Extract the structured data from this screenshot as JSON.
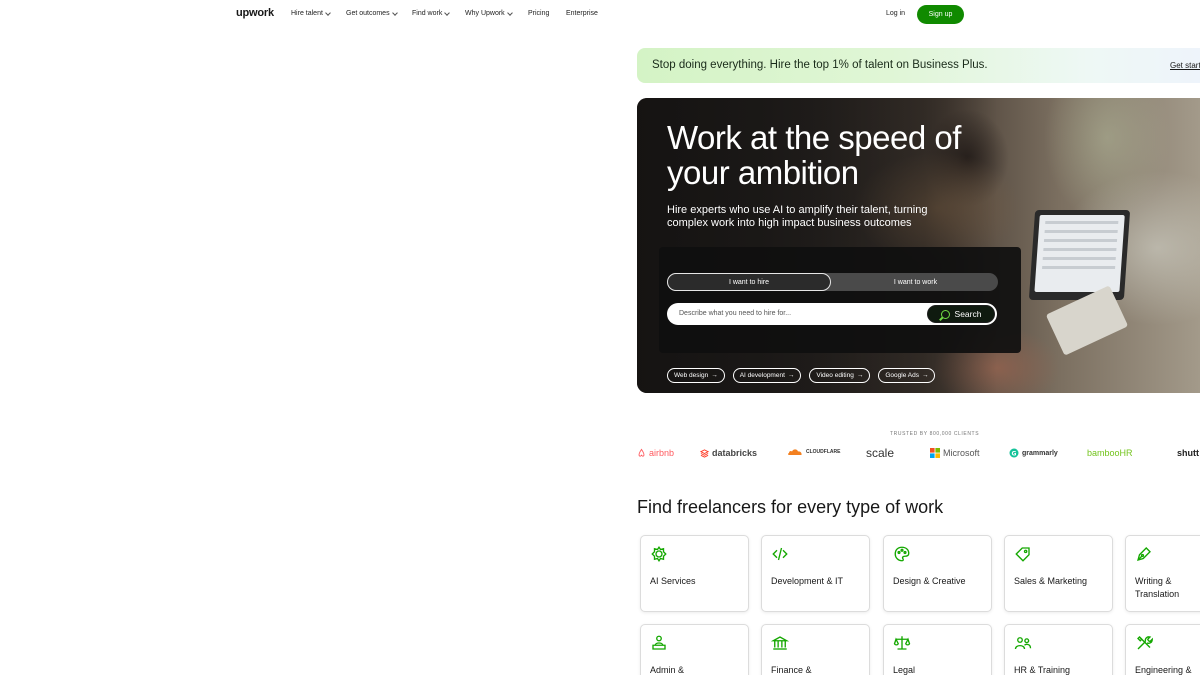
{
  "header": {
    "logo": "upwork",
    "nav": [
      {
        "label": "Hire talent",
        "dropdown": true
      },
      {
        "label": "Get outcomes",
        "dropdown": true
      },
      {
        "label": "Find work",
        "dropdown": true
      },
      {
        "label": "Why Upwork",
        "dropdown": true
      },
      {
        "label": "Pricing",
        "dropdown": false
      },
      {
        "label": "Enterprise",
        "dropdown": false
      }
    ],
    "login": "Log in",
    "signup": "Sign up"
  },
  "promo": {
    "text": "Stop doing everything. Hire the top 1% of talent on Business Plus.",
    "link": "Get started"
  },
  "hero": {
    "title": "Work at the speed of your ambition",
    "subtitle": "Hire experts who use AI to amplify their talent, turning complex work into high impact business outcomes",
    "tabs": [
      "I want to hire",
      "I want to work"
    ],
    "search_placeholder": "Describe what you need to hire for...",
    "search_button": "Search",
    "chips": [
      "Web design",
      "AI development",
      "Video editing",
      "Google Ads"
    ]
  },
  "trusted": {
    "label": "TRUSTED BY 800,000 CLIENTS",
    "brands": [
      "airbnb",
      "databricks",
      "CLOUDFLARE",
      "scale",
      "Microsoft",
      "grammarly",
      "bambooHR",
      "shutt"
    ]
  },
  "categories": {
    "title": "Find freelancers for every type of work",
    "items": [
      {
        "label": "AI Services",
        "icon": "ai-services-icon"
      },
      {
        "label": "Development & IT",
        "icon": "code-icon"
      },
      {
        "label": "Design & Creative",
        "icon": "palette-icon"
      },
      {
        "label": "Sales & Marketing",
        "icon": "tag-icon"
      },
      {
        "label": "Writing & Translation",
        "icon": "pen-icon"
      },
      {
        "label": "Admin &",
        "icon": "admin-icon"
      },
      {
        "label": "Finance &",
        "icon": "bank-icon"
      },
      {
        "label": "Legal",
        "icon": "scales-icon"
      },
      {
        "label": "HR & Training",
        "icon": "people-icon"
      },
      {
        "label": "Engineering &",
        "icon": "tools-icon"
      }
    ]
  },
  "colors": {
    "accent": "#108a00",
    "icon_green": "#14a800",
    "text": "#181818"
  }
}
